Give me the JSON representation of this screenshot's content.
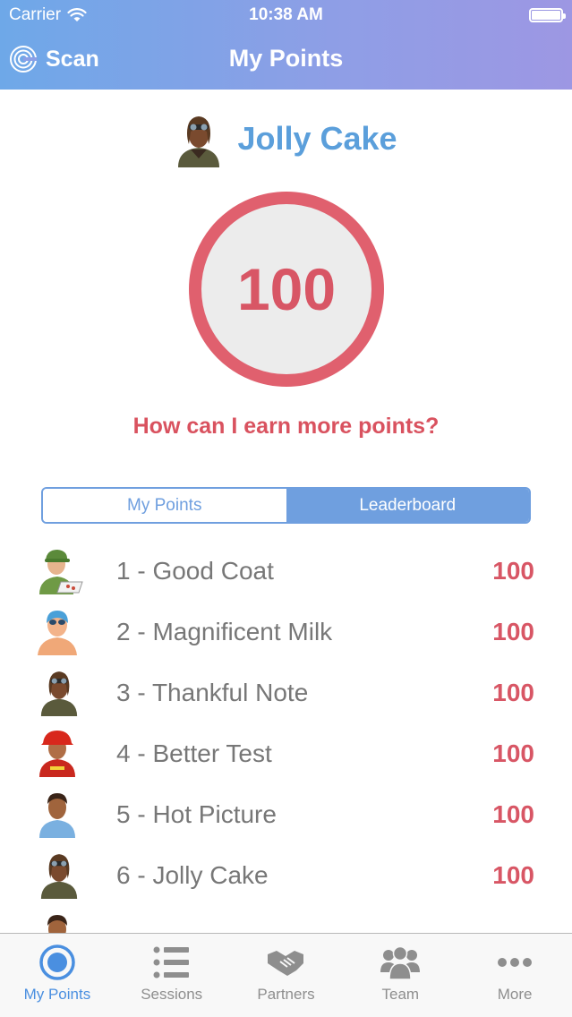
{
  "status_bar": {
    "carrier": "Carrier",
    "time": "10:38 AM"
  },
  "nav": {
    "left_button": "Scan",
    "title": "My Points"
  },
  "profile": {
    "name": "Jolly Cake",
    "avatar": "pilot-avatar"
  },
  "points": {
    "value": "100",
    "ring_color": "#e0606e"
  },
  "earn_link": "How can I earn more points?",
  "segments": {
    "left": "My Points",
    "right": "Leaderboard",
    "selected": "Leaderboard"
  },
  "leaderboard": [
    {
      "label": "1 - Good Coat",
      "score": "100",
      "avatar": "pizza-delivery-avatar"
    },
    {
      "label": "2 - Magnificent Milk",
      "score": "100",
      "avatar": "swimmer-avatar"
    },
    {
      "label": "3 - Thankful Note",
      "score": "100",
      "avatar": "pilot-avatar"
    },
    {
      "label": "4 - Better Test",
      "score": "100",
      "avatar": "firefighter-avatar"
    },
    {
      "label": "5 - Hot Picture",
      "score": "100",
      "avatar": "man-avatar"
    },
    {
      "label": "6 - Jolly Cake",
      "score": "100",
      "avatar": "pilot-avatar"
    }
  ],
  "tabs": [
    {
      "label": "My Points",
      "icon": "target-icon",
      "active": true
    },
    {
      "label": "Sessions",
      "icon": "list-icon",
      "active": false
    },
    {
      "label": "Partners",
      "icon": "handshake-icon",
      "active": false
    },
    {
      "label": "Team",
      "icon": "team-icon",
      "active": false
    },
    {
      "label": "More",
      "icon": "more-icon",
      "active": false
    }
  ],
  "colors": {
    "accent": "#6f9fdf",
    "points_red": "#d85665",
    "name_blue": "#5b9fdb",
    "header_start": "#6ea8e8",
    "header_end": "#9d97e3"
  }
}
